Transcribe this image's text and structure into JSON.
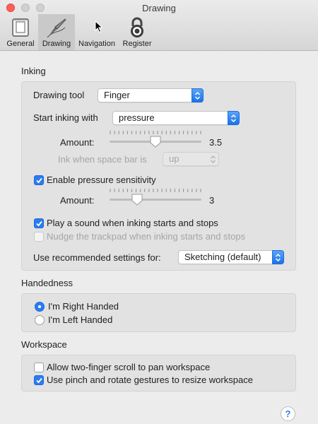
{
  "window": {
    "title": "Drawing"
  },
  "toolbar": {
    "items": [
      {
        "label": "General",
        "icon": "general-panel-icon"
      },
      {
        "label": "Drawing",
        "icon": "pen-tool-icon",
        "selected": true
      },
      {
        "label": "Navigation",
        "icon": "navigation-icon"
      },
      {
        "label": "Register",
        "icon": "padlock-icon"
      }
    ]
  },
  "inking": {
    "title": "Inking",
    "drawing_tool_label": "Drawing tool",
    "drawing_tool_value": "Finger",
    "start_inking_label": "Start inking with",
    "start_inking_value": "pressure",
    "amount_label": "Amount:",
    "amount_value": "3.5",
    "amount_fraction": 0.5,
    "space_bar_label": "Ink when space bar is",
    "space_bar_value": "up",
    "enable_pressure_label": "Enable pressure sensitivity",
    "enable_pressure_checked": true,
    "pressure_amount_label": "Amount:",
    "pressure_amount_value": "3",
    "pressure_amount_fraction": 0.27,
    "play_sound_label": "Play a sound when inking starts and stops",
    "play_sound_checked": true,
    "nudge_label": "Nudge the trackpad when inking starts and stops",
    "nudge_checked": false,
    "recommended_label": "Use recommended settings for:",
    "recommended_value": "Sketching (default)"
  },
  "handedness": {
    "title": "Handedness",
    "right_label": "I'm Right Handed",
    "left_label": "I'm Left Handed",
    "selected": "right"
  },
  "workspace": {
    "title": "Workspace",
    "two_finger_label": "Allow two-finger scroll to pan workspace",
    "two_finger_checked": false,
    "pinch_label": "Use pinch and rotate gestures to resize workspace",
    "pinch_checked": true
  },
  "help": {
    "label": "?"
  },
  "colors": {
    "accent": "#2b7cf0",
    "close_button": "#fc5f57",
    "window_bg": "#ececec"
  }
}
